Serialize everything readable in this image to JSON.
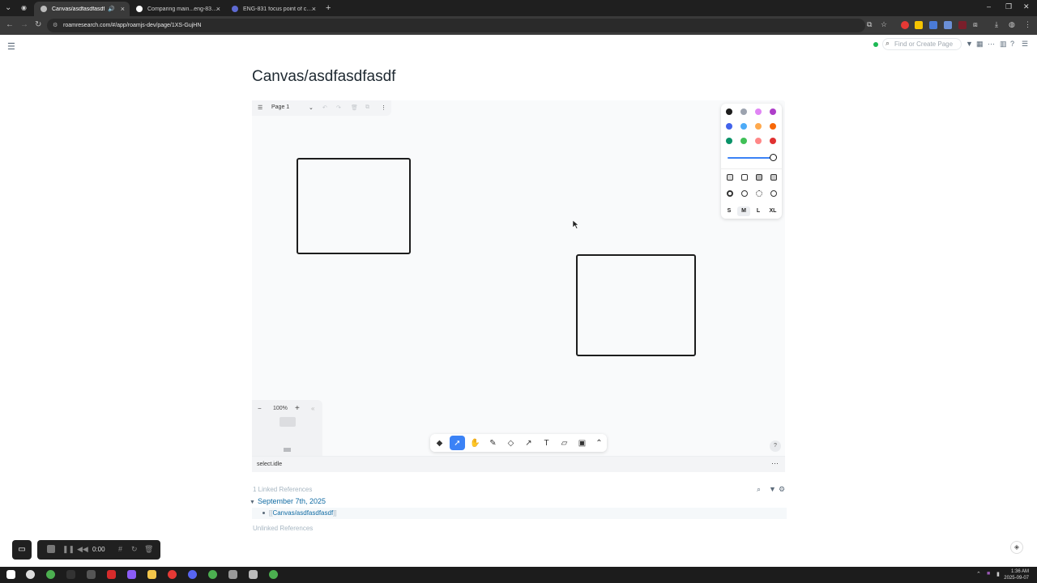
{
  "browser": {
    "tabs": [
      {
        "title": "Canvas/asdfasdfasdf",
        "active": true
      },
      {
        "title": "Comparing main...eng-831-foc",
        "active": false
      },
      {
        "title": "ENG-831 focus point of canvas",
        "active": false
      }
    ],
    "url": "roamresearch.com/#/app/roamjs-dev/page/1XS-GujHN"
  },
  "header": {
    "search_placeholder": "Find or Create Page"
  },
  "page": {
    "title": "Canvas/asdfasdfasdf"
  },
  "canvas": {
    "page_name": "Page 1",
    "zoom": "100%",
    "status": "select.idle",
    "style_panel": {
      "colors": [
        "#1d1d1d",
        "#9ca3af",
        "#e085f4",
        "#ae3ec9",
        "#4263eb",
        "#4dabf7",
        "#ffa94d",
        "#f76707",
        "#099268",
        "#40c057",
        "#ff8787",
        "#e03131"
      ],
      "sizes": [
        "S",
        "M",
        "L",
        "XL"
      ],
      "selected_size": "M"
    },
    "tools": [
      "discourse-node-icon",
      "select-icon",
      "hand-icon",
      "draw-icon",
      "eraser-icon",
      "arrow-icon",
      "text-icon",
      "note-icon",
      "asset-icon",
      "more-icon"
    ],
    "selected_tool": "select-icon",
    "help": "?"
  },
  "references": {
    "linked_title": "1 Linked References",
    "date": "September 7th, 2025",
    "block_open": "[[",
    "block_text": "Canvas/asdfasdfasdf",
    "block_close": "]]",
    "unlinked_title": "Unlinked References"
  },
  "recorder": {
    "time": "0:00"
  },
  "taskbar": {
    "time": "1:36 AM",
    "date": "2025-09-07"
  }
}
